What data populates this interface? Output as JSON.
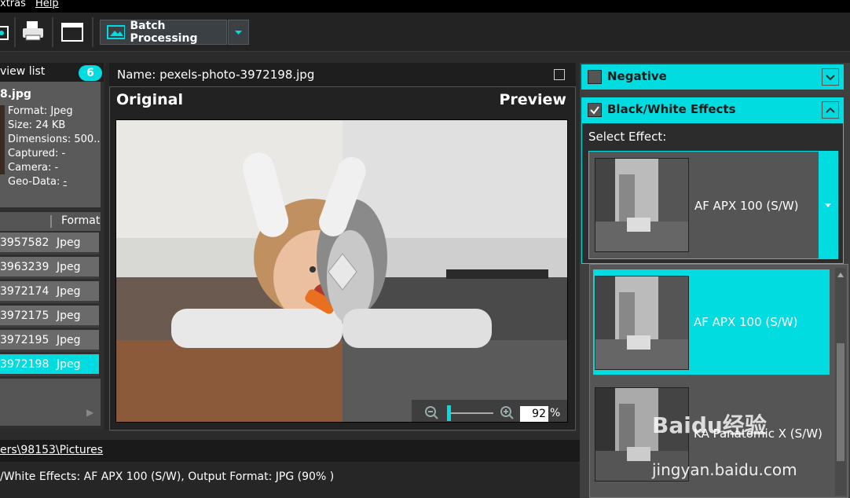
{
  "menubar": {
    "items": [
      "xtras",
      "Help"
    ]
  },
  "toolbar": {
    "batch_label": "Batch Processing"
  },
  "left_panel": {
    "header": "view list",
    "count": "6",
    "file_name": "8.jpg",
    "info": {
      "format": "Format: Jpeg",
      "size": "Size: 24 KB",
      "dimensions": "Dimensions: 500...",
      "captured": "Captured: -",
      "camera": "Camera: -",
      "geo_label": "Geo-Data: ",
      "geo_value": "-"
    },
    "list_header": "Format",
    "rows": [
      {
        "id": "3957582",
        "format": "Jpeg"
      },
      {
        "id": "3963239",
        "format": "Jpeg"
      },
      {
        "id": "3972174",
        "format": "Jpeg"
      },
      {
        "id": "3972175",
        "format": "Jpeg"
      },
      {
        "id": "3972195",
        "format": "Jpeg"
      },
      {
        "id": "3972198",
        "format": "Jpeg"
      }
    ]
  },
  "center": {
    "name": "Name: pexels-photo-3972198.jpg",
    "original_label": "Original",
    "preview_label": "Preview",
    "zoom_value": "92",
    "zoom_unit": "%"
  },
  "status": {
    "path": "ers\\98153\\Pictures",
    "text": "/White Effects: AF APX 100 (S/W), Output Format: JPG (90% )"
  },
  "right_panel": {
    "negative_label": "Negative",
    "bw_label": "Black/White Effects",
    "select_label": "Select Effect:",
    "selected_effect": "AF APX 100 (S/W)",
    "options": [
      "AF APX 100 (S/W)",
      "KA Panatomic X (S/W)"
    ]
  },
  "watermark": {
    "brand": "Baidu经验",
    "url": "jingyan.baidu.com"
  },
  "colors": {
    "accent": "#00dcdf",
    "dark": "#1e1e1e"
  }
}
